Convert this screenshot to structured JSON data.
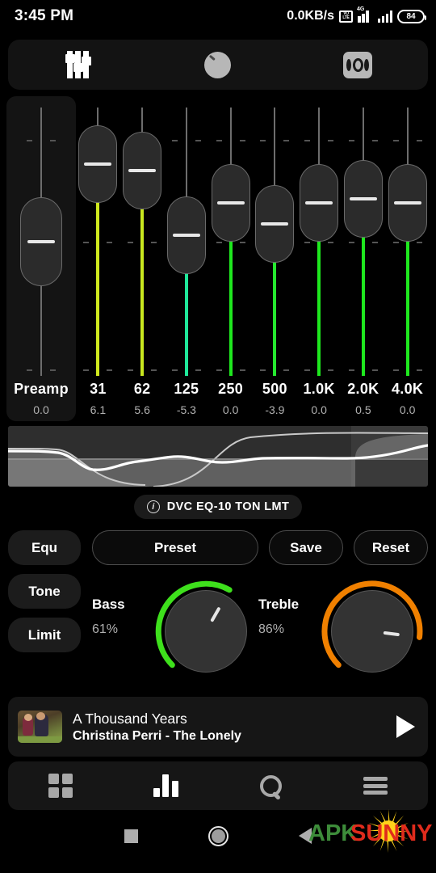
{
  "statusbar": {
    "time": "3:45 PM",
    "network_speed": "0.0KB/s",
    "volte_top": "VO",
    "volte_bottom": "LTE",
    "network_type": "4G",
    "battery": "84"
  },
  "toolbar": {
    "items": [
      {
        "name": "equalizer-sliders-icon",
        "active": true
      },
      {
        "name": "knob-dial-icon",
        "active": false
      },
      {
        "name": "surround-speaker-icon",
        "active": false
      }
    ]
  },
  "equalizer": {
    "preamp": {
      "label": "Preamp",
      "value": "0.0",
      "pos": 0.5,
      "color": "#6d6d6d"
    },
    "bands": [
      {
        "label": "31",
        "value": "6.1",
        "pos": 0.79,
        "color": "#cfe81e"
      },
      {
        "label": "62",
        "value": "5.6",
        "pos": 0.765,
        "color": "#c9e81e"
      },
      {
        "label": "125",
        "value": "-5.3",
        "pos": 0.525,
        "color": "#1fe89a"
      },
      {
        "label": "250",
        "value": "0.0",
        "pos": 0.645,
        "color": "#1ee81e"
      },
      {
        "label": "500",
        "value": "-3.9",
        "pos": 0.565,
        "color": "#25e82f"
      },
      {
        "label": "1.0K",
        "value": "0.0",
        "pos": 0.645,
        "color": "#1ee81e"
      },
      {
        "label": "2.0K",
        "value": "0.5",
        "pos": 0.66,
        "color": "#1ee81e"
      },
      {
        "label": "4.0K",
        "value": "0.0",
        "pos": 0.645,
        "color": "#1ee81e"
      }
    ]
  },
  "graph": {
    "badge_label": "DVC EQ-10 TON LMT",
    "info_icon_char": "i"
  },
  "controls": {
    "side_buttons": [
      {
        "label": "Equ"
      },
      {
        "label": "Tone"
      },
      {
        "label": "Limit"
      }
    ],
    "top_buttons": [
      {
        "label": "Preset"
      },
      {
        "label": "Save"
      },
      {
        "label": "Reset"
      }
    ],
    "knobs": [
      {
        "name": "Bass",
        "value": "61%",
        "percent": 61,
        "color": "#3ee01c"
      },
      {
        "name": "Treble",
        "value": "86%",
        "percent": 86,
        "color": "#f08000"
      }
    ]
  },
  "now_playing": {
    "title": "A Thousand Years",
    "subtitle": "Christina Perri - The Lonely",
    "play_icon": "play-icon"
  },
  "bottom_nav": {
    "items": [
      {
        "name": "nav-grid",
        "icon": "grid-icon",
        "active": false
      },
      {
        "name": "nav-equalizer",
        "icon": "equalizer-bars-icon",
        "active": true
      },
      {
        "name": "nav-search",
        "icon": "search-icon",
        "active": false
      },
      {
        "name": "nav-menu",
        "icon": "menu-icon",
        "active": false
      }
    ]
  },
  "android_nav": {
    "recents": "square-icon",
    "home": "circle-icon",
    "back": "triangle-back-icon"
  },
  "watermark": {
    "part1": "APK",
    "part2": "SUNNY",
    "color1": "#3d8c3a",
    "color2": "#e02b1c",
    "sun_color": "#ffd21a"
  }
}
